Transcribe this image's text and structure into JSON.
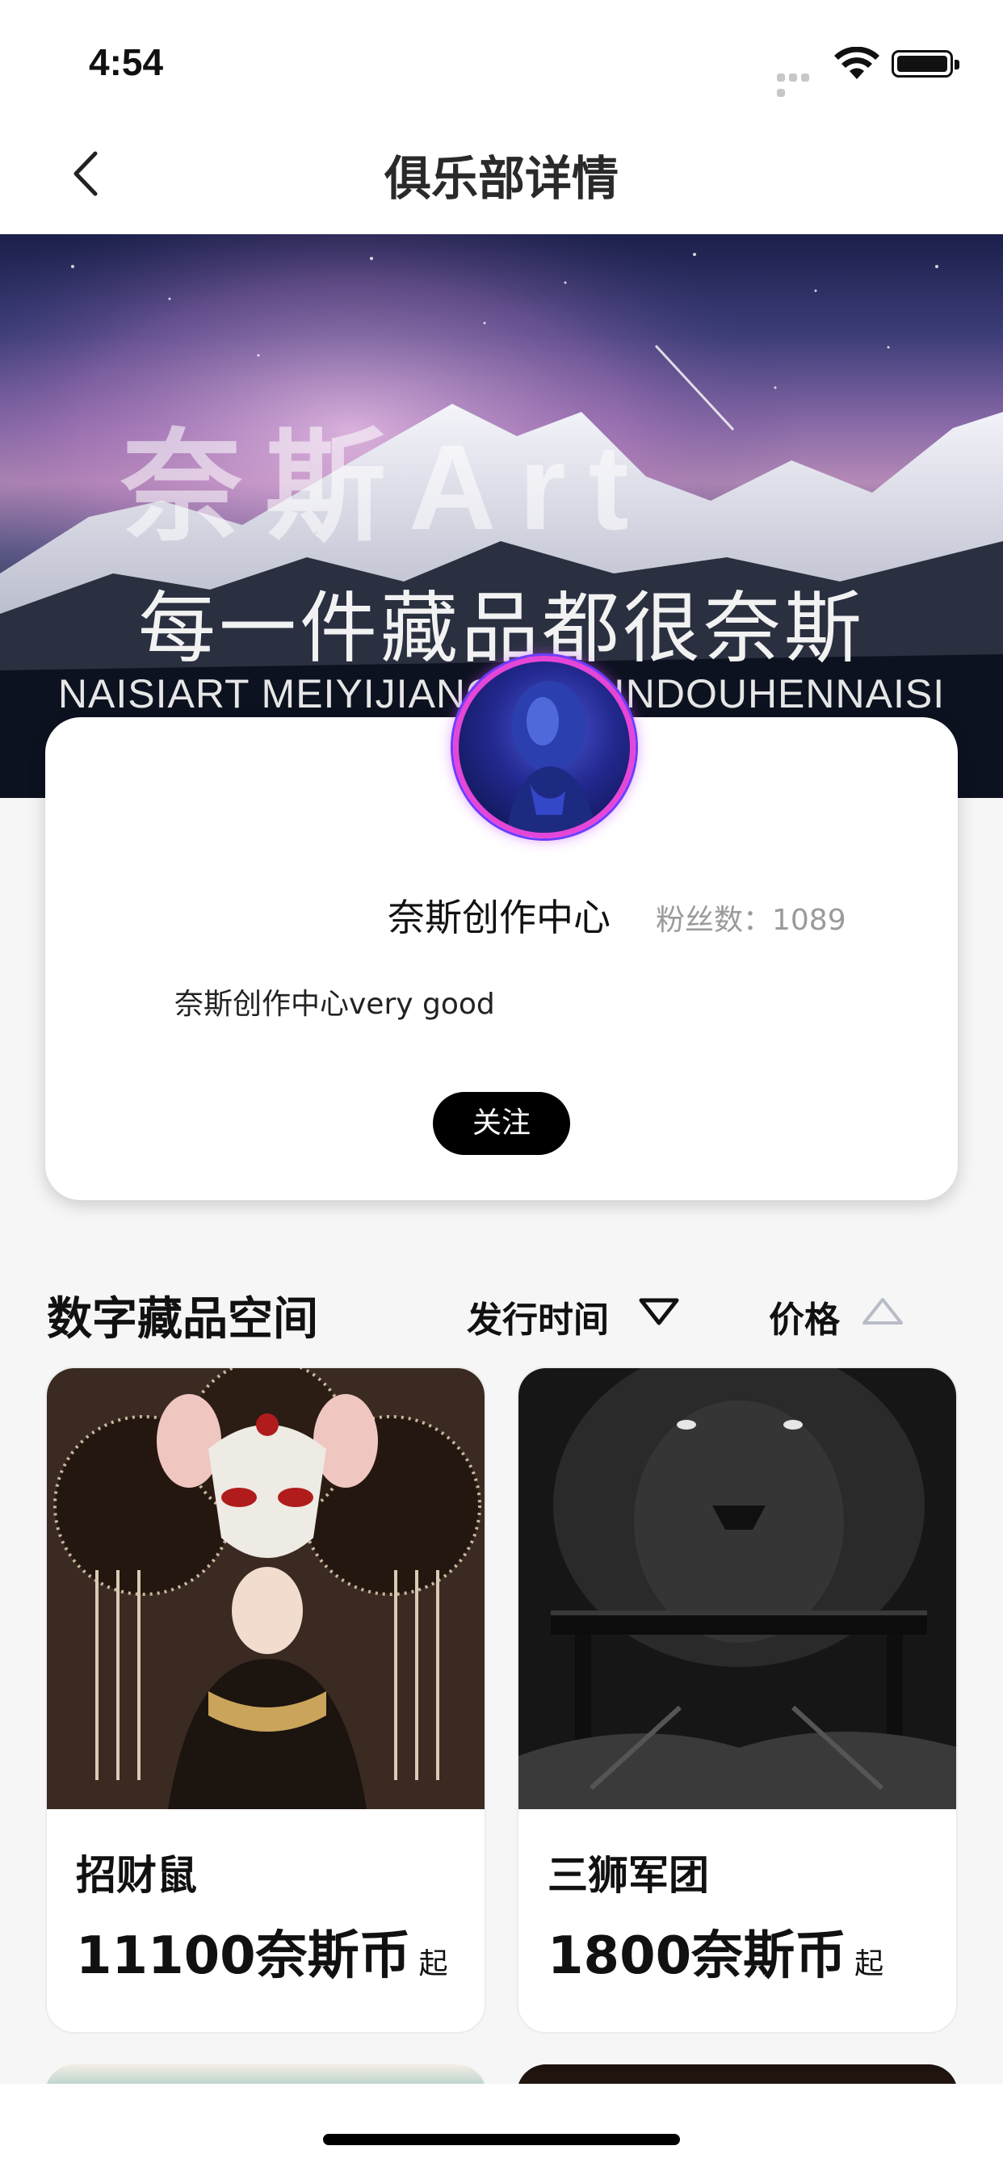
{
  "status_bar": {
    "time": "4:54"
  },
  "nav": {
    "title": "俱乐部详情",
    "back_icon": "chevron-left-icon"
  },
  "banner": {
    "big_text": "奈斯Art",
    "slogan": "每一件藏品都很奈斯",
    "pinyin": "NAISIART MEIYIJIANCANGPINDOUHENNAISI"
  },
  "club": {
    "name": "奈斯创作中心",
    "fans_label": "粉丝数：1089",
    "description": "奈斯创作中心very good",
    "follow_label": "关注"
  },
  "collection": {
    "title": "数字藏品空间",
    "sort_time_label": "发行时间",
    "sort_time_icon": "triangle-down-outline-icon",
    "sort_price_label": "价格",
    "sort_price_icon": "triangle-up-outline-icon",
    "items": [
      {
        "name": "招财鼠",
        "price": "11100奈斯币",
        "suffix": "起"
      },
      {
        "name": "三狮军团",
        "price": "1800奈斯币",
        "suffix": "起"
      }
    ]
  }
}
